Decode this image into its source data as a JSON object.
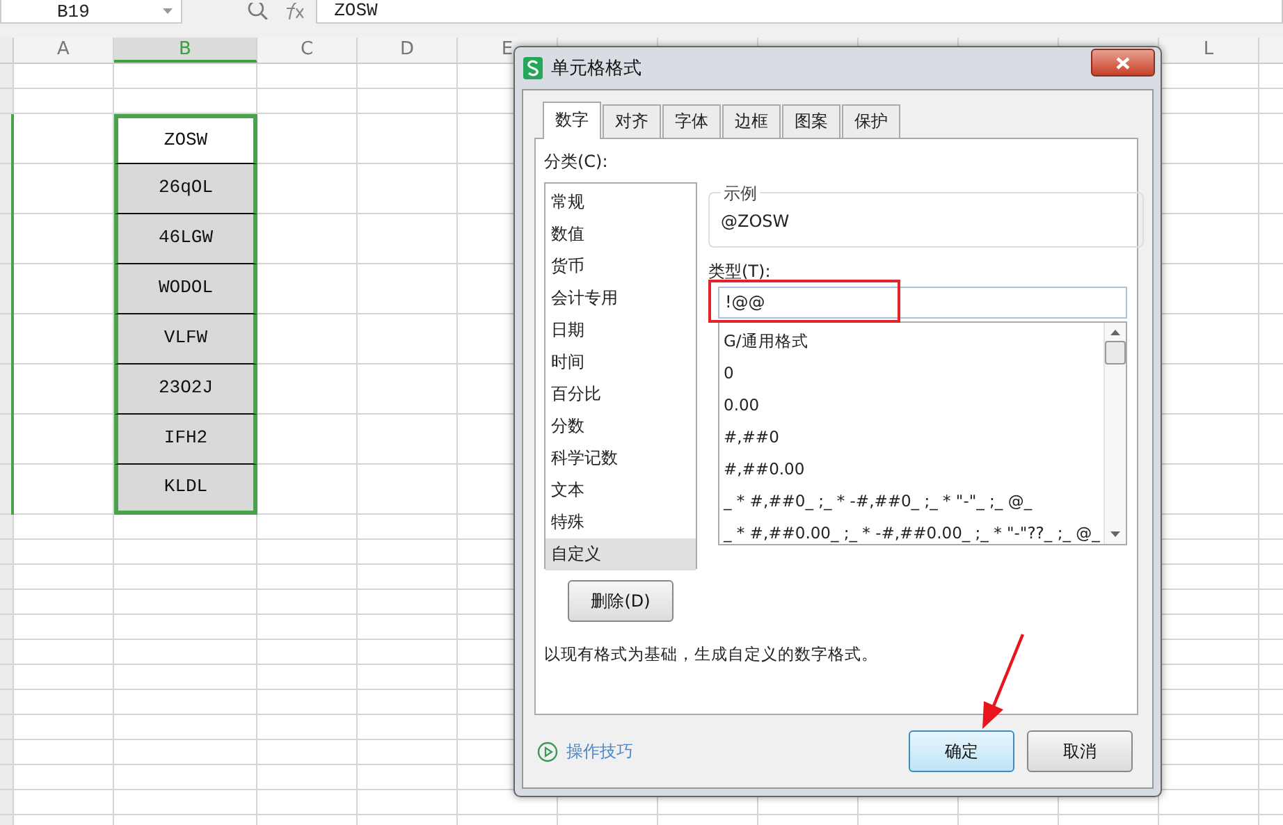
{
  "formula_bar": {
    "cell_reference": "B19",
    "formula": "ZOSW"
  },
  "columns": [
    {
      "label": "A",
      "selected": false
    },
    {
      "label": "B",
      "selected": true
    },
    {
      "label": "C",
      "selected": false
    },
    {
      "label": "D",
      "selected": false
    },
    {
      "label": "E",
      "selected": false
    },
    {
      "selected": false
    },
    {
      "selected": false
    },
    {
      "selected": false
    },
    {
      "selected": false
    },
    {
      "selected": false
    },
    {
      "selected": false
    },
    {
      "label": "L",
      "selected": false
    }
  ],
  "cells": [
    {
      "text": "ZOSW",
      "kind": "active"
    },
    {
      "text": "26qOL",
      "kind": "selected"
    },
    {
      "text": "46LGW",
      "kind": "selected"
    },
    {
      "text": "WODOL",
      "kind": "selected"
    },
    {
      "text": "VLFW",
      "kind": "selected"
    },
    {
      "text": "23O2J",
      "kind": "selected"
    },
    {
      "text": "IFH2",
      "kind": "selected"
    },
    {
      "text": "KLDL",
      "kind": "selected"
    }
  ],
  "dialog": {
    "title": "单元格格式",
    "tabs": [
      {
        "label": "数字",
        "selected": true
      },
      {
        "label": "对齐",
        "selected": false
      },
      {
        "label": "字体",
        "selected": false
      },
      {
        "label": "边框",
        "selected": false
      },
      {
        "label": "图案",
        "selected": false
      },
      {
        "label": "保护",
        "selected": false
      }
    ],
    "category_label": "分类(C):",
    "categories": [
      {
        "label": "常规",
        "selected": false
      },
      {
        "label": "数值",
        "selected": false
      },
      {
        "label": "货币",
        "selected": false
      },
      {
        "label": "会计专用",
        "selected": false
      },
      {
        "label": "日期",
        "selected": false
      },
      {
        "label": "时间",
        "selected": false
      },
      {
        "label": "百分比",
        "selected": false
      },
      {
        "label": "分数",
        "selected": false
      },
      {
        "label": "科学记数",
        "selected": false
      },
      {
        "label": "文本",
        "selected": false
      },
      {
        "label": "特殊",
        "selected": false
      },
      {
        "label": "自定义",
        "selected": true
      }
    ],
    "sample_label": "示例",
    "sample_value": "@ZOSW",
    "type_label": "类型(T):",
    "type_value": "!@@",
    "formats": [
      "G/通用格式",
      "0",
      "0.00",
      "#,##0",
      "#,##0.00",
      "_ * #,##0_ ;_ * -#,##0_ ;_ * \"-\"_ ;_ @_",
      "_ * #,##0.00_ ;_ * -#,##0.00_ ;_ * \"-\"??_ ;_ @_"
    ],
    "delete_button": "删除(D)",
    "description": "以现有格式为基础，生成自定义的数字格式。",
    "tips_link": "操作技巧",
    "ok_button": "确定",
    "cancel_button": "取消"
  }
}
